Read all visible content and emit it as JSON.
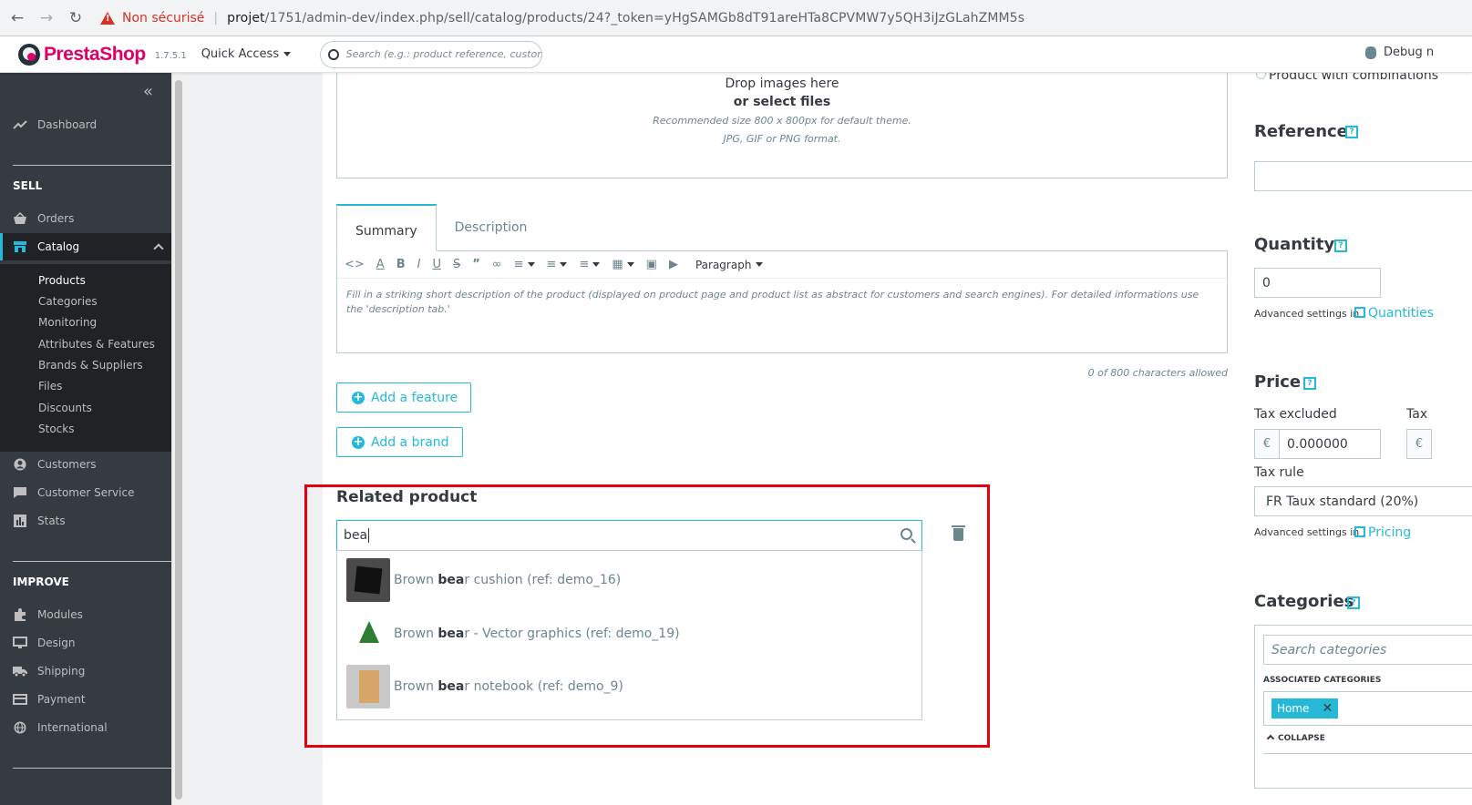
{
  "browser": {
    "not_secure": "Non sécurisé",
    "url_host": "projet",
    "url_path": "/1751/admin-dev/index.php/sell/catalog/products/24?_token=yHgSAMGb8dT91areHTa8CPVMW7y5QH3iJzGLahZMM5s"
  },
  "header": {
    "logo": "PrestaShop",
    "version": "1.7.5.1",
    "quick_access": "Quick Access",
    "search_placeholder": "Search (e.g.: product reference, custome",
    "debug": "Debug n"
  },
  "sidebar": {
    "dashboard": "Dashboard",
    "sell_section": "SELL",
    "orders": "Orders",
    "catalog": "Catalog",
    "catalog_sub": [
      "Products",
      "Categories",
      "Monitoring",
      "Attributes & Features",
      "Brands & Suppliers",
      "Files",
      "Discounts",
      "Stocks"
    ],
    "customers": "Customers",
    "customer_service": "Customer Service",
    "stats": "Stats",
    "improve_section": "IMPROVE",
    "modules": "Modules",
    "design": "Design",
    "shipping": "Shipping",
    "payment": "Payment",
    "international": "International"
  },
  "dropzone": {
    "line1": "Drop images here",
    "line2": "or select files",
    "hint1": "Recommended size 800 x 800px for default theme.",
    "hint2": "JPG, GIF or PNG format."
  },
  "tabs": {
    "summary": "Summary",
    "description": "Description"
  },
  "editor": {
    "paragraph": "Paragraph",
    "placeholder": "Fill in a striking short description of the product (displayed on product page and product list as abstract for customers and search engines). For detailed informations use the 'description tab.'",
    "char_count": "0 of 800 characters allowed"
  },
  "buttons": {
    "add_feature": "Add a feature",
    "add_brand": "Add a brand"
  },
  "related": {
    "title": "Related product",
    "query": "bea",
    "results": [
      {
        "pre": "Brown ",
        "match": "bea",
        "post": "r cushion (ref: demo_16)"
      },
      {
        "pre": "Brown ",
        "match": "bea",
        "post": "r - Vector graphics (ref: demo_19)"
      },
      {
        "pre": "Brown ",
        "match": "bea",
        "post": "r notebook (ref: demo_9)"
      }
    ]
  },
  "right": {
    "combinations": "Product with combinations",
    "reference": "Reference",
    "quantity": "Quantity",
    "quantity_value": "0",
    "advanced_settings": "Advanced settings in",
    "quantities_link": "Quantities",
    "price": "Price",
    "tax_excluded": "Tax excluded",
    "tax_included_cut": "Tax",
    "currency": "€",
    "price_value": "0.000000",
    "tax_rule": "Tax rule",
    "tax_rule_value": "FR Taux standard (20%)",
    "pricing_link": "Pricing",
    "categories": "Categories",
    "search_categories": "Search categories",
    "associated_categories": "ASSOCIATED CATEGORIES",
    "home_tag": "Home",
    "collapse": "COLLAPSE"
  },
  "help_mark": "?"
}
